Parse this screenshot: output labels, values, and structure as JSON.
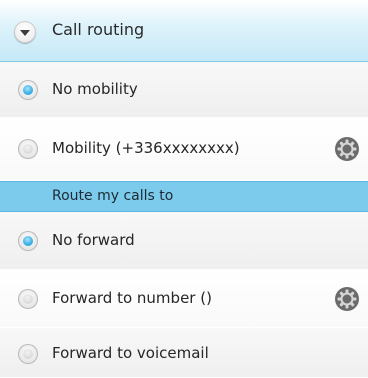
{
  "header": {
    "title": "Call routing",
    "icon": "chevron-down-icon"
  },
  "mobility_options": [
    {
      "label": "No mobility",
      "selected": true
    },
    {
      "label": "Mobility (+336xxxxxxxx)",
      "selected": false,
      "action_icon": "gear-icon"
    }
  ],
  "section": {
    "title": "Route my calls to"
  },
  "forward_options": [
    {
      "label": "No forward",
      "selected": true
    },
    {
      "label": "Forward to number ()",
      "selected": false,
      "action_icon": "gear-icon"
    },
    {
      "label": "Forward to voicemail",
      "selected": false
    }
  ],
  "colors": {
    "accent": "#7ccbec",
    "radio_selected": "#27a7e3",
    "gear": "#6b6b6b"
  }
}
